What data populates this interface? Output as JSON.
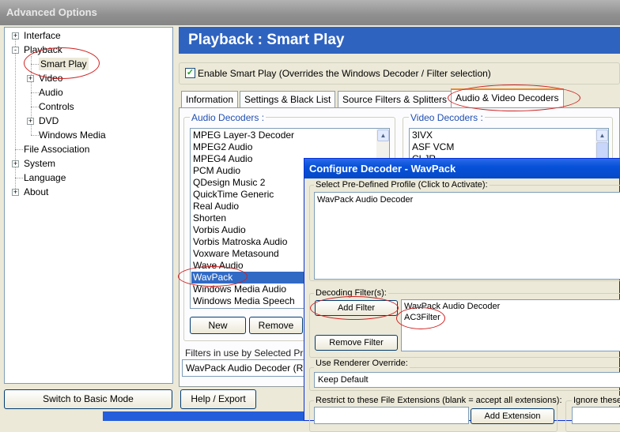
{
  "window": {
    "title": "Advanced Options"
  },
  "tree": {
    "items": [
      {
        "label": "Interface",
        "expander": "+"
      },
      {
        "label": "Playback",
        "expander": "-"
      },
      {
        "label": "Smart Play",
        "expander": ""
      },
      {
        "label": "Video",
        "expander": "+"
      },
      {
        "label": "Audio",
        "expander": ""
      },
      {
        "label": "Controls",
        "expander": ""
      },
      {
        "label": "DVD",
        "expander": "+"
      },
      {
        "label": "Windows Media",
        "expander": ""
      },
      {
        "label": "File Association",
        "expander": ""
      },
      {
        "label": "System",
        "expander": "+"
      },
      {
        "label": "Language",
        "expander": ""
      },
      {
        "label": "About",
        "expander": "+"
      }
    ]
  },
  "header": {
    "title": "Playback : Smart Play"
  },
  "smart_play": {
    "checked_mark": "✓",
    "enable_label": "Enable Smart Play (Overrides the Windows Decoder / Filter selection)"
  },
  "tabs": [
    "Information",
    "Settings & Black List",
    "Source Filters & Splitters",
    "Audio & Video Decoders"
  ],
  "audio_decoders": {
    "label": "Audio Decoders :",
    "items": [
      "MPEG Layer-3 Decoder",
      "MPEG2 Audio",
      "MPEG4 Audio",
      "PCM Audio",
      "QDesign Music 2",
      "QuickTime Generic",
      "Real Audio",
      "Shorten",
      "Vorbis Audio",
      "Vorbis Matroska Audio",
      "Voxware Metasound",
      "Wave Audio",
      "WavPack",
      "Windows Media Audio",
      "Windows Media Speech"
    ],
    "selected": "WavPack"
  },
  "video_decoders": {
    "label": "Video Decoders :",
    "items": [
      "3IVX",
      "ASF VCM",
      "CLJR"
    ]
  },
  "buttons": {
    "new": "New",
    "remove": "Remove"
  },
  "filters_in_use": {
    "label": "Filters in use by Selected Pr",
    "value": "WavPack Audio Decoder (R"
  },
  "bottom": {
    "switch_mode": "Switch to Basic Mode",
    "help_export": "Help / Export"
  },
  "dialog": {
    "title": "Configure Decoder - WavPack",
    "profile_legend": "Select Pre-Defined Profile (Click to Activate):",
    "profiles": [
      "WavPack Audio Decoder"
    ],
    "decoding_legend": "Decoding Filter(s):",
    "add_filter": "Add Filter",
    "remove_filter": "Remove Filter",
    "filters": [
      "WavPack Audio Decoder",
      "AC3Filter"
    ],
    "renderer_legend": "Use Renderer Override:",
    "renderer_value": "Keep Default",
    "restrict_legend": "Restrict to these File Extensions (blank = accept all extensions):",
    "add_extension": "Add Extension",
    "ignore_legend": "Ignore these"
  },
  "colors": {
    "header_blue": "#2f63c0",
    "selection_blue": "#316ac5",
    "annotation_red": "#d02020",
    "dialog_title_blue": "#0751d9"
  }
}
